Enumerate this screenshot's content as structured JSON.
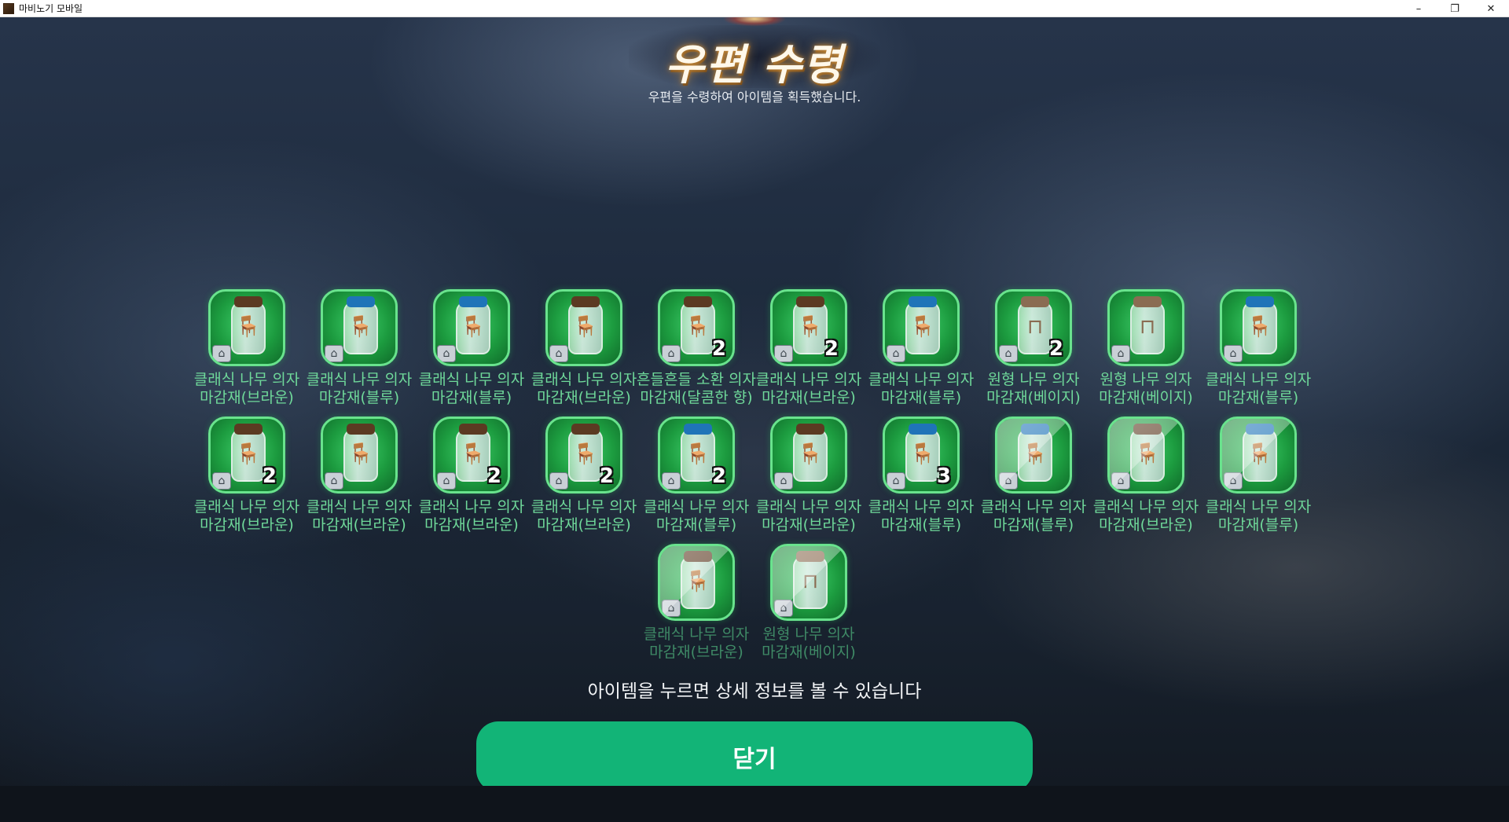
{
  "window": {
    "title": "마비노기 모바일",
    "controls": {
      "minimize": "–",
      "restore": "❐",
      "close": "✕"
    }
  },
  "popup": {
    "title": "우편 수령",
    "subtitle": "우편을 수령하여 아이템을 획득했습니다.",
    "hint": "아이템을 누르면 상세 정보를 볼 수 있습니다",
    "close_label": "닫기"
  },
  "colors": {
    "item_bg": "#1c9b3f",
    "item_border": "#69e38d",
    "item_name": "#6fd99a",
    "close_button": "#12b477",
    "lid_brown": "#5b3a22",
    "lid_blue": "#1f74b8",
    "lid_beige": "#8a6c52"
  },
  "items": [
    {
      "line1": "클래식 나무 의자",
      "line2": "마감재(브라운)",
      "qty": "",
      "lid": "brown",
      "glyph": "chair-icon"
    },
    {
      "line1": "클래식 나무 의자",
      "line2": "마감재(블루)",
      "qty": "",
      "lid": "blue",
      "glyph": "chair-icon"
    },
    {
      "line1": "클래식 나무 의자",
      "line2": "마감재(블루)",
      "qty": "",
      "lid": "blue",
      "glyph": "chair-icon"
    },
    {
      "line1": "클래식 나무 의자",
      "line2": "마감재(브라운)",
      "qty": "",
      "lid": "brown",
      "glyph": "chair-icon"
    },
    {
      "line1": "흔들흔들 소환 의자",
      "line2": "마감재(달콤한 향)",
      "qty": "2",
      "lid": "brown",
      "glyph": "rocking-chair-icon"
    },
    {
      "line1": "클래식 나무 의자",
      "line2": "마감재(브라운)",
      "qty": "2",
      "lid": "brown",
      "glyph": "chair-icon"
    },
    {
      "line1": "클래식 나무 의자",
      "line2": "마감재(블루)",
      "qty": "",
      "lid": "blue",
      "glyph": "chair-icon"
    },
    {
      "line1": "원형 나무 의자",
      "line2": "마감재(베이지)",
      "qty": "2",
      "lid": "beige",
      "glyph": "stool-icon"
    },
    {
      "line1": "원형 나무 의자",
      "line2": "마감재(베이지)",
      "qty": "",
      "lid": "beige",
      "glyph": "stool-icon"
    },
    {
      "line1": "클래식 나무 의자",
      "line2": "마감재(블루)",
      "qty": "",
      "lid": "blue",
      "glyph": "chair-icon"
    },
    {
      "line1": "클래식 나무 의자",
      "line2": "마감재(브라운)",
      "qty": "2",
      "lid": "brown",
      "glyph": "chair-icon"
    },
    {
      "line1": "클래식 나무 의자",
      "line2": "마감재(브라운)",
      "qty": "",
      "lid": "brown",
      "glyph": "chair-icon"
    },
    {
      "line1": "클래식 나무 의자",
      "line2": "마감재(브라운)",
      "qty": "2",
      "lid": "brown",
      "glyph": "chair-icon"
    },
    {
      "line1": "클래식 나무 의자",
      "line2": "마감재(브라운)",
      "qty": "2",
      "lid": "brown",
      "glyph": "chair-icon"
    },
    {
      "line1": "클래식 나무 의자",
      "line2": "마감재(블루)",
      "qty": "2",
      "lid": "blue",
      "glyph": "chair-icon"
    },
    {
      "line1": "클래식 나무 의자",
      "line2": "마감재(브라운)",
      "qty": "",
      "lid": "brown",
      "glyph": "chair-icon"
    },
    {
      "line1": "클래식 나무 의자",
      "line2": "마감재(블루)",
      "qty": "3",
      "lid": "blue",
      "glyph": "chair-icon"
    },
    {
      "line1": "클래식 나무 의자",
      "line2": "마감재(블루)",
      "qty": "",
      "lid": "blue",
      "glyph": "chair-icon"
    },
    {
      "line1": "클래식 나무 의자",
      "line2": "마감재(브라운)",
      "qty": "",
      "lid": "brown",
      "glyph": "chair-icon"
    },
    {
      "line1": "클래식 나무 의자",
      "line2": "마감재(블루)",
      "qty": "",
      "lid": "blue",
      "glyph": "chair-icon"
    },
    {
      "line1": "클래식 나무 의자",
      "line2": "마감재(브라운)",
      "qty": "",
      "lid": "brown",
      "glyph": "chair-icon"
    },
    {
      "line1": "원형 나무 의자",
      "line2": "마감재(베이지)",
      "qty": "",
      "lid": "beige",
      "glyph": "stool-icon"
    }
  ]
}
